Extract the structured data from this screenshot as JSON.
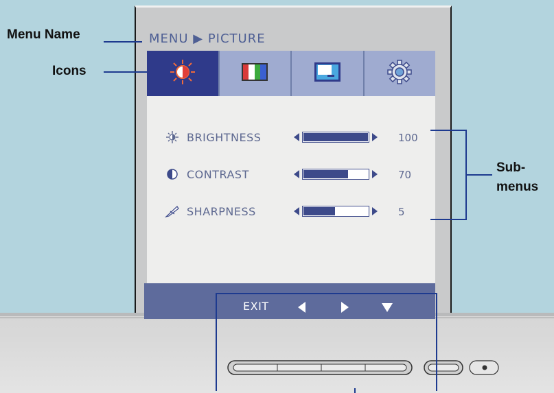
{
  "callouts": {
    "menu_name": "Menu Name",
    "icons": "Icons",
    "sub_menus_line1": "Sub-",
    "sub_menus_line2": "menus"
  },
  "osd": {
    "title": "MENU ▶ PICTURE",
    "tabs": [
      {
        "icon": "brightness-sun-icon",
        "active": true
      },
      {
        "icon": "color-bars-icon",
        "active": false
      },
      {
        "icon": "display-position-icon",
        "active": false
      },
      {
        "icon": "setup-gear-icon",
        "active": false
      }
    ],
    "rows": [
      {
        "icon": "sun-icon",
        "label": "BRIGHTNESS",
        "value": "100",
        "level": 1.0
      },
      {
        "icon": "contrast-icon",
        "label": "CONTRAST",
        "value": "70",
        "level": 0.7
      },
      {
        "icon": "sharpness-icon",
        "label": "SHARPNESS",
        "value": "5",
        "level": 0.5
      }
    ],
    "footer": {
      "exit": "EXIT",
      "left": "◀",
      "right": "▶",
      "down": "▼"
    }
  },
  "colors": {
    "accent": "#2f3a8a",
    "callout_line": "#1d3a8f",
    "background": "#b3d4de"
  }
}
